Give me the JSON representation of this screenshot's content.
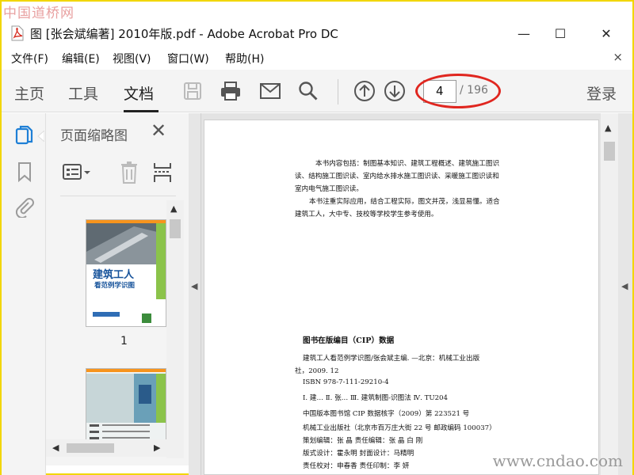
{
  "watermarks": {
    "top": "中国道桥网",
    "bottom": "www.cndao.com"
  },
  "window": {
    "title": "图 [张会斌编著] 2010年版.pdf - Adobe Acrobat Pro DC",
    "minimize": "—",
    "maximize": "☐",
    "close": "✕"
  },
  "menu": {
    "items": [
      "文件(F)",
      "编辑(E)",
      "视图(V)",
      "窗口(W)",
      "帮助(H)"
    ],
    "close": "×"
  },
  "toolbar": {
    "tabs": [
      "主页",
      "工具",
      "文档"
    ],
    "active_tab": "文档",
    "page_current": "4",
    "page_total": "/ 196",
    "login": "登录"
  },
  "panel": {
    "title": "页面缩略图",
    "close": "✕",
    "thumbnails": [
      {
        "label": "1",
        "cover_title": "建筑工人",
        "cover_subtitle": "看范例学识图"
      },
      {
        "label": ""
      }
    ]
  },
  "document": {
    "intro_lines": [
      "本书内容包括：制图基本知识、建筑工程概述、建筑施工图识",
      "读、结构施工图识读、室内给水排水施工图识读、采暖施工图识读和",
      "室内电气施工图识读。",
      "本书注重实际应用，结合工程实际，图文并茂，浅显易懂。适合",
      "建筑工人，大中专、技校等学校学生参考使用。"
    ],
    "cip_heading": "图书在版编目（CIP）数据",
    "cip_lines": [
      "建筑工人看范例学识图/张会斌主编. —北京：机械工业出版",
      "社，2009. 12",
      "ISBN 978-7-111-29210-4",
      "Ⅰ. 建…  Ⅱ. 张…  Ⅲ. 建筑制图-识图法  Ⅳ. TU204",
      "中国版本图书馆 CIP 数据核字（2009）第 223521 号"
    ],
    "publisher_lines": [
      "机械工业出版社（北京市百万庄大街 22 号   邮政编码 100037）",
      "策划编辑：张  晶   责任编辑：张  晶  白  刚",
      "版式设计：霍永明   封面设计：马精明",
      "责任校对：申春香   责任印制：李  妍"
    ]
  },
  "colors": {
    "highlight": "#e0261f",
    "acrobat_red": "#d62b1f"
  }
}
